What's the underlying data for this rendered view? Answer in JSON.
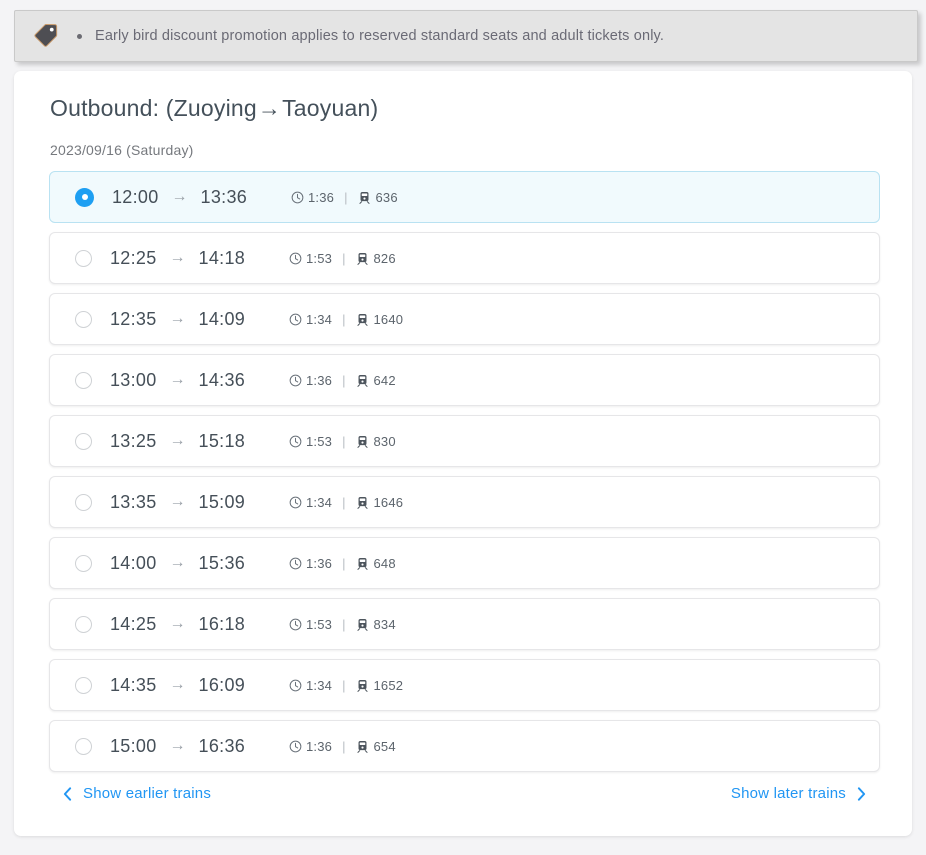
{
  "notice": {
    "icon": "tag-icon",
    "text": "Early bird discount promotion applies to reserved standard seats and adult tickets only."
  },
  "card": {
    "title_prefix": "Outbound: (Zuoying",
    "title_arrow": "→",
    "title_suffix": "Taoyuan)",
    "date": "2023/09/16 (Saturday)"
  },
  "colors": {
    "accent": "#1e9ff2",
    "link": "#2196f3",
    "selected_row_bg": "#f1fafd",
    "selected_row_border": "#b9e2f2",
    "banner_bg": "#e4e4e4",
    "text_primary": "#454f58",
    "text_muted": "#76797e"
  },
  "icons": {
    "clock": "clock-icon",
    "train": "train-icon",
    "chevron_left": "chevron-left-icon",
    "chevron_right": "chevron-right-icon"
  },
  "trains": [
    {
      "depart": "12:00",
      "arrow": "→",
      "arrive": "13:36",
      "duration": "1:36",
      "separator": "|",
      "number": "636",
      "selected": true
    },
    {
      "depart": "12:25",
      "arrow": "→",
      "arrive": "14:18",
      "duration": "1:53",
      "separator": "|",
      "number": "826",
      "selected": false
    },
    {
      "depart": "12:35",
      "arrow": "→",
      "arrive": "14:09",
      "duration": "1:34",
      "separator": "|",
      "number": "1640",
      "selected": false
    },
    {
      "depart": "13:00",
      "arrow": "→",
      "arrive": "14:36",
      "duration": "1:36",
      "separator": "|",
      "number": "642",
      "selected": false
    },
    {
      "depart": "13:25",
      "arrow": "→",
      "arrive": "15:18",
      "duration": "1:53",
      "separator": "|",
      "number": "830",
      "selected": false
    },
    {
      "depart": "13:35",
      "arrow": "→",
      "arrive": "15:09",
      "duration": "1:34",
      "separator": "|",
      "number": "1646",
      "selected": false
    },
    {
      "depart": "14:00",
      "arrow": "→",
      "arrive": "15:36",
      "duration": "1:36",
      "separator": "|",
      "number": "648",
      "selected": false
    },
    {
      "depart": "14:25",
      "arrow": "→",
      "arrive": "16:18",
      "duration": "1:53",
      "separator": "|",
      "number": "834",
      "selected": false
    },
    {
      "depart": "14:35",
      "arrow": "→",
      "arrive": "16:09",
      "duration": "1:34",
      "separator": "|",
      "number": "1652",
      "selected": false
    },
    {
      "depart": "15:00",
      "arrow": "→",
      "arrive": "16:36",
      "duration": "1:36",
      "separator": "|",
      "number": "654",
      "selected": false
    }
  ],
  "footer": {
    "earlier_label": "Show earlier trains",
    "later_label": "Show later trains"
  }
}
